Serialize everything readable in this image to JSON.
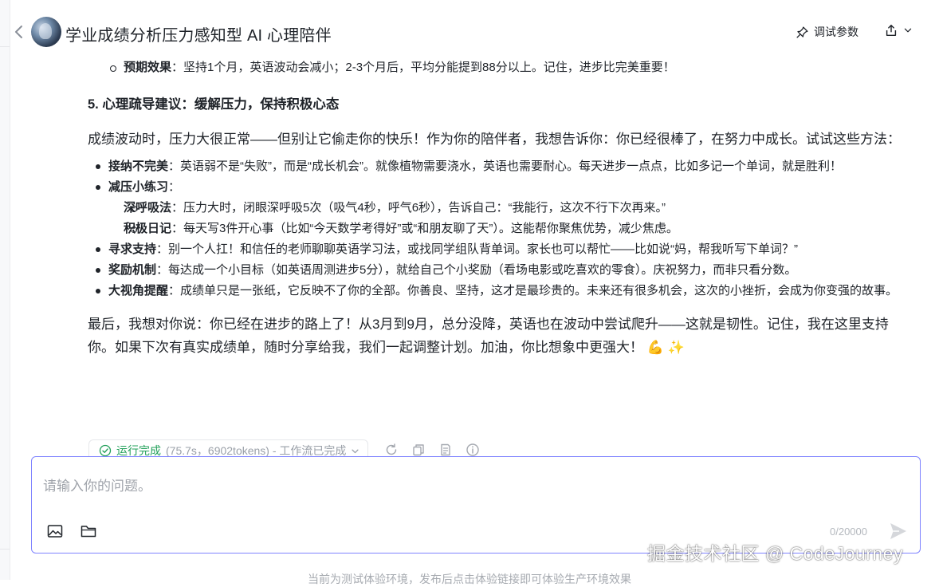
{
  "header": {
    "title": "学业成绩分析压力感知型 AI 心理陪伴",
    "debug_label": "调试参数"
  },
  "message": {
    "expected_effect": {
      "label": "预期效果",
      "text": "：坚持1个月，英语波动会减小；2-3个月后，平均分能提到88分以上。记住，进步比完美重要！"
    },
    "section5_title": "5. 心理疏导建议：缓解压力，保持积极心态",
    "intro": "成绩波动时，压力大很正常——但别让它偷走你的快乐！作为你的陪伴者，我想告诉你：你已经很棒了，在努力中成长。试试这些方法：",
    "items": [
      {
        "label": "接纳不完美",
        "text": "：英语弱不是“失败”，而是“成长机会”。就像植物需要浇水，英语也需要耐心。每天进步一点点，比如多记一个单词，就是胜利！"
      },
      {
        "label": "减压小练习",
        "text": "："
      },
      {
        "label": "寻求支持",
        "text": "：别一个人扛！和信任的老师聊聊英语学习法，或找同学组队背单词。家长也可以帮忙——比如说“妈，帮我听写下单词？”"
      },
      {
        "label": "奖励机制",
        "text": "：每达成一个小目标（如英语周测进步5分），就给自己个小奖励（看场电影或吃喜欢的零食）。庆祝努力，而非只看分数。"
      },
      {
        "label": "大视角提醒",
        "text": "：成绩单只是一张纸，它反映不了你的全部。你善良、坚持，这才是最珍贵的。未来还有很多机会，这次的小挫折，会成为你变强的故事。"
      }
    ],
    "subitems": [
      {
        "label": "深呼吸法",
        "text": "：压力大时，闭眼深呼吸5次（吸气4秒，呼气6秒），告诉自己：“我能行，这次不行下次再来。”"
      },
      {
        "label": "积极日记",
        "text": "：每天写3件开心事（比如“今天数学考得好”或“和朋友聊了天”）。这能帮你聚焦优势，减少焦虑。"
      }
    ],
    "closing": "最后，我想对你说：你已经在进步的路上了！从3月到9月，总分没降，英语也在波动中尝试爬升——这就是韧性。记住，我在这里支持你。如果下次有真实成绩单，随时分享给我，我们一起调整计划。加油，你比想象中更强大！",
    "emojis": "💪 ✨"
  },
  "status": {
    "state": "运行完成",
    "detail": "(75.7s，6902tokens) - 工作流已完成"
  },
  "input": {
    "placeholder": "请输入你的问题。",
    "counter": "0/20000"
  },
  "footer": "当前为测试体验环境，发布后点击体验链接即可体验生产环境效果",
  "watermark": "掘金技术社区 @ CodeJourney",
  "colors": {
    "accent_border": "#7f83ff",
    "success": "#22a05a"
  }
}
